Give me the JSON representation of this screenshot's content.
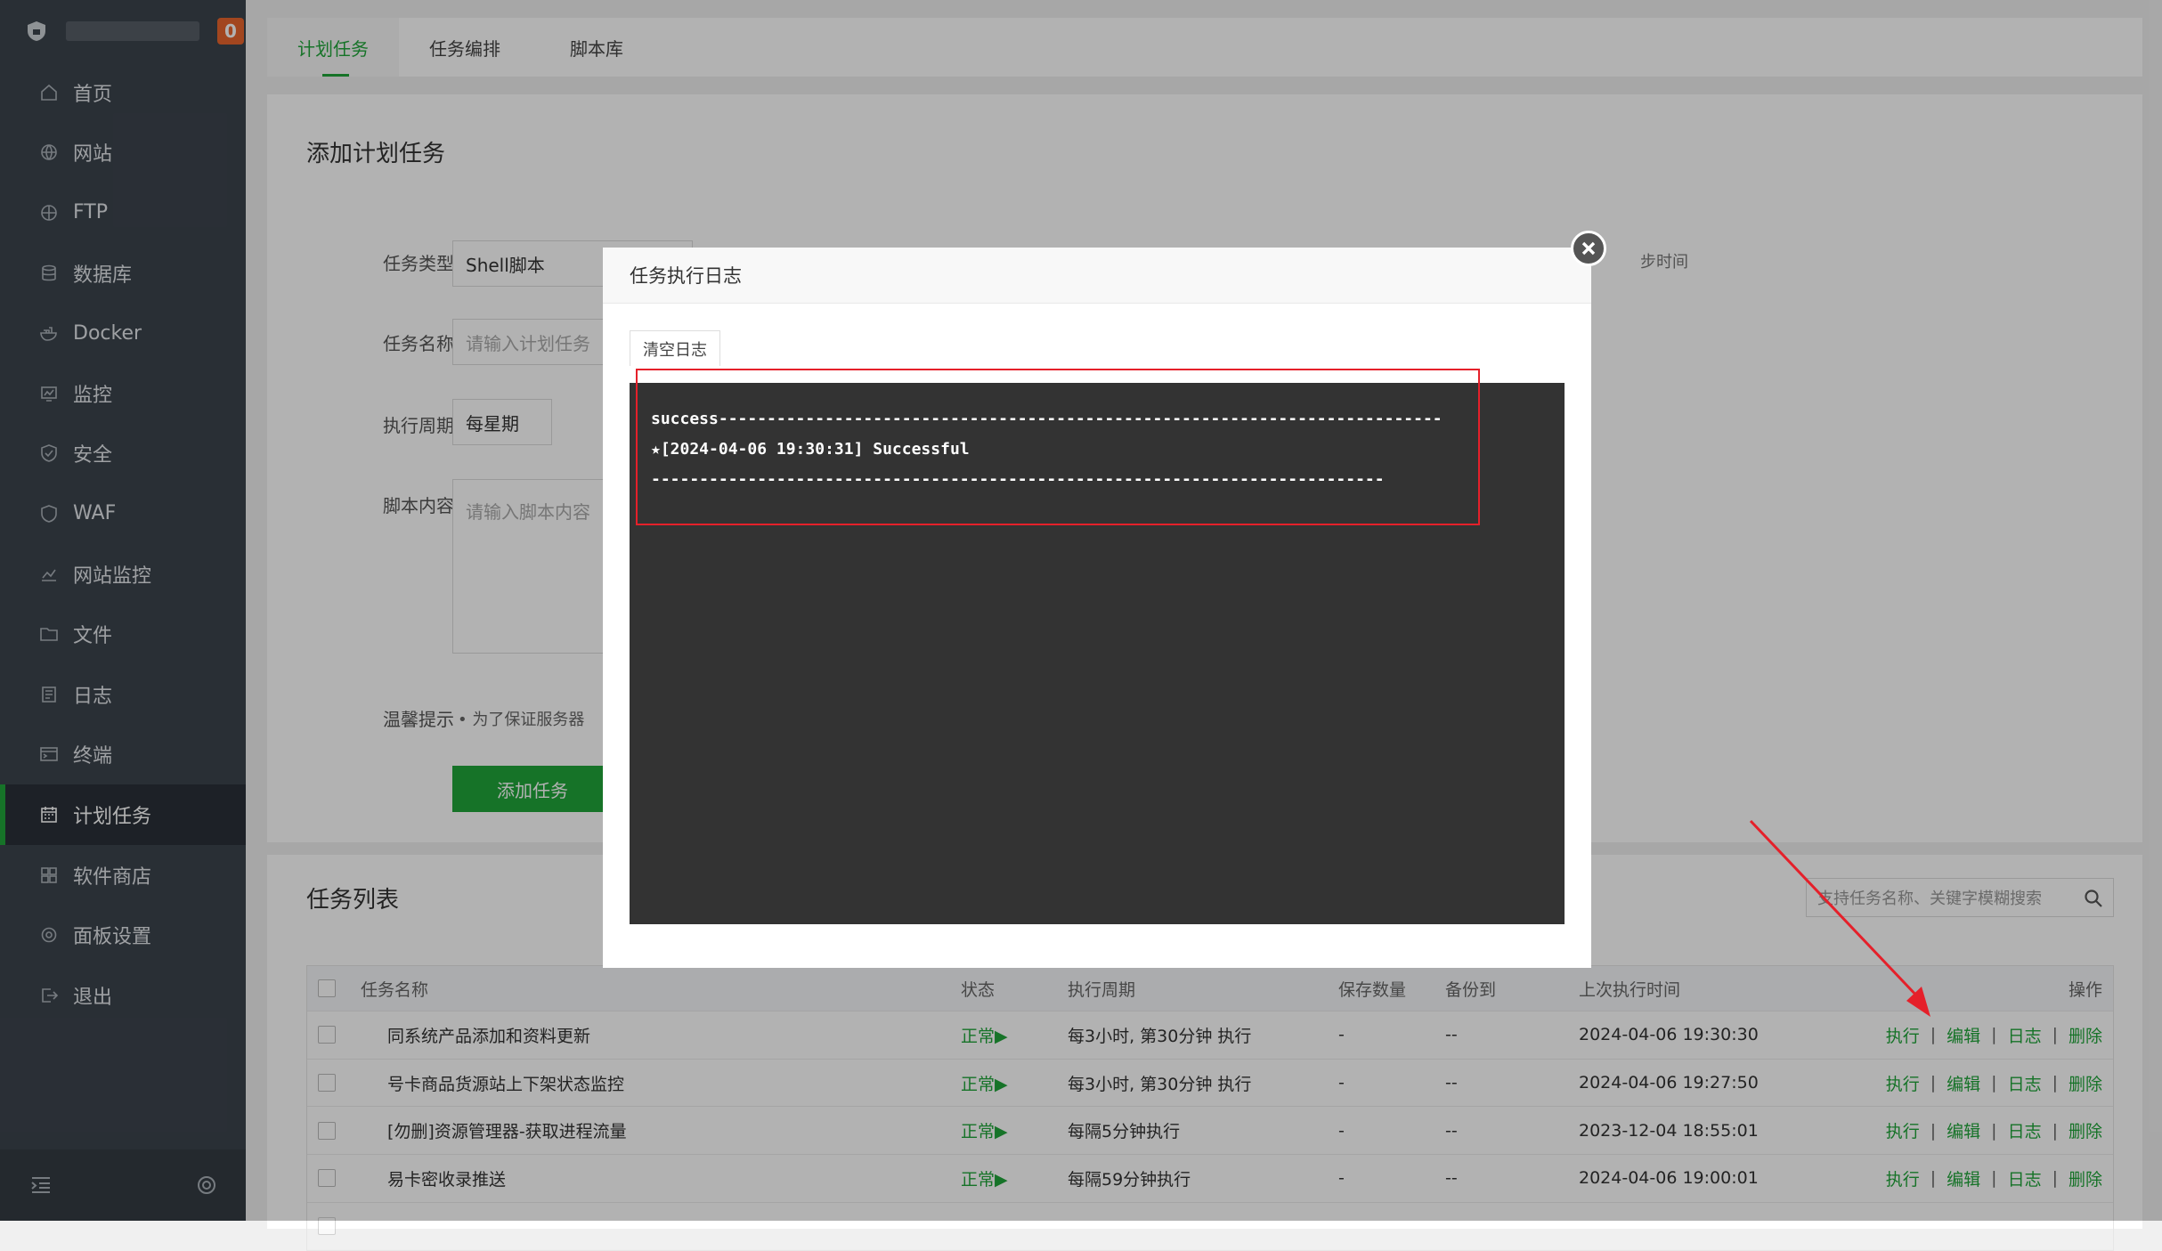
{
  "sidebar": {
    "badge": "0",
    "items": [
      {
        "label": "首页",
        "icon": "home-icon"
      },
      {
        "label": "网站",
        "icon": "globe-icon"
      },
      {
        "label": "FTP",
        "icon": "ftp-icon"
      },
      {
        "label": "数据库",
        "icon": "database-icon"
      },
      {
        "label": "Docker",
        "icon": "docker-icon"
      },
      {
        "label": "监控",
        "icon": "monitor-icon"
      },
      {
        "label": "安全",
        "icon": "shield-icon"
      },
      {
        "label": "WAF",
        "icon": "waf-icon"
      },
      {
        "label": "网站监控",
        "icon": "chart-line-icon"
      },
      {
        "label": "文件",
        "icon": "folder-icon"
      },
      {
        "label": "日志",
        "icon": "log-icon"
      },
      {
        "label": "终端",
        "icon": "terminal-icon"
      },
      {
        "label": "计划任务",
        "icon": "calendar-icon",
        "active": true
      },
      {
        "label": "软件商店",
        "icon": "grid-icon"
      },
      {
        "label": "面板设置",
        "icon": "gear-icon"
      },
      {
        "label": "退出",
        "icon": "logout-icon"
      }
    ]
  },
  "tabs": [
    "计划任务",
    "任务编排",
    "脚本库"
  ],
  "add_task": {
    "title": "添加计划任务",
    "type_label": "任务类型",
    "type_value": "Shell脚本",
    "name_label": "任务名称",
    "name_placeholder": "请输入计划任务",
    "cycle_label": "执行周期",
    "cycle_value": "每星期",
    "script_label": "脚本内容",
    "script_placeholder": "请输入脚本内容",
    "tip_label": "温馨提示",
    "tip_text": "为了保证服务器",
    "sync_hint": "步时间",
    "add_button": "添加任务"
  },
  "task_list": {
    "title": "任务列表",
    "search_placeholder": "支持任务名称、关键字模糊搜索",
    "columns": [
      "任务名称",
      "状态",
      "执行周期",
      "保存数量",
      "备份到",
      "上次执行时间",
      "操作"
    ],
    "rows": [
      {
        "name": "同系统产品添加和资料更新",
        "status": "正常▶",
        "cycle": "每3小时, 第30分钟 执行",
        "save": "-",
        "backup": "--",
        "last": "2024-04-06 19:30:30"
      },
      {
        "name": "号卡商品货源站上下架状态监控",
        "status": "正常▶",
        "cycle": "每3小时, 第30分钟 执行",
        "save": "-",
        "backup": "--",
        "last": "2024-04-06 19:27:50"
      },
      {
        "name": "[勿删]资源管理器-获取进程流量",
        "status": "正常▶",
        "cycle": "每隔5分钟执行",
        "save": "-",
        "backup": "--",
        "last": "2023-12-04 18:55:01"
      },
      {
        "name": "易卡密收录推送",
        "status": "正常▶",
        "cycle": "每隔59分钟执行",
        "save": "-",
        "backup": "--",
        "last": "2024-04-06 19:00:01"
      }
    ],
    "actions": {
      "run": "执行",
      "edit": "编辑",
      "log": "日志",
      "delete": "删除",
      "sep": "|"
    }
  },
  "modal": {
    "title": "任务执行日志",
    "clear_button": "清空日志",
    "log_lines": [
      "success---------------------------------------------------------------------------",
      "★[2024-04-06 19:30:31] Successful",
      "----------------------------------------------------------------------------"
    ]
  },
  "colors": {
    "accent": "#20a53a",
    "sidebar": "#3c444d",
    "annotation": "#e5202a",
    "log_bg": "#333333"
  }
}
